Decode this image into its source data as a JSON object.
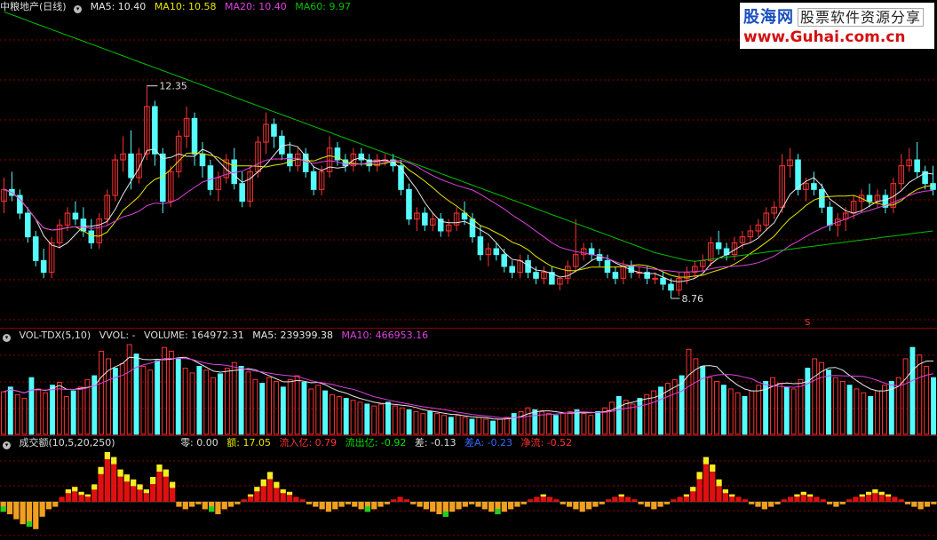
{
  "price_panel": {
    "stock_name": "中粮地产(日线)",
    "ma5": "MA5: 10.40",
    "ma10": "MA10: 10.58",
    "ma20": "MA20: 10.40",
    "ma60": "MA60: 9.97",
    "high_label": "12.35",
    "low_label": "8.76",
    "marker": "S"
  },
  "vol_panel": {
    "indicator": "VOL-TDX(5,10)",
    "vvol": "VVOL: -",
    "volume": "VOLUME: 164972.31",
    "ma5": "MA5: 239399.38",
    "ma10": "MA10: 466953.16"
  },
  "amount_panel": {
    "indicator": "成交额(10,5,20,250)",
    "ling": "零: 0.00",
    "e": "额: 17.05",
    "inflow": "流入亿: 0.79",
    "outflow": "流出亿: -0.92",
    "diff": "差: -0.13",
    "diff_a": "差A: -0.23",
    "net": "净流: -0.52"
  },
  "watermark": {
    "line1": "股海网",
    "line1b": "股票软件资源分享",
    "line2": "www.Guhai.com.cn"
  },
  "colors": {
    "up": "#ff3333",
    "down": "#54fcfc",
    "ma5": "#e6e6e6",
    "ma10": "#e6e600",
    "ma20": "#e040e0",
    "ma60": "#00c000",
    "grid": "#8b0000"
  },
  "chart_data": [
    {
      "type": "candlestick",
      "title": "中粮地产(日线)",
      "ylim": [
        8.4,
        13.5
      ],
      "annotations": [
        {
          "label": "12.35",
          "value": 12.35
        },
        {
          "label": "8.76",
          "value": 8.76
        }
      ],
      "ohlc": [
        [
          10.4,
          10.8,
          10.2,
          10.6
        ],
        [
          10.6,
          10.9,
          10.4,
          10.5
        ],
        [
          10.5,
          10.6,
          10.1,
          10.2
        ],
        [
          10.2,
          10.3,
          9.7,
          9.8
        ],
        [
          9.8,
          9.9,
          9.3,
          9.4
        ],
        [
          9.4,
          9.6,
          9.1,
          9.2
        ],
        [
          9.2,
          9.8,
          9.1,
          9.7
        ],
        [
          9.7,
          10.1,
          9.6,
          10.0
        ],
        [
          10.0,
          10.3,
          9.9,
          10.2
        ],
        [
          10.2,
          10.4,
          10.0,
          10.1
        ],
        [
          10.1,
          10.3,
          9.8,
          9.9
        ],
        [
          9.9,
          10.1,
          9.6,
          9.7
        ],
        [
          9.7,
          10.2,
          9.6,
          10.1
        ],
        [
          10.1,
          10.6,
          10.0,
          10.5
        ],
        [
          10.5,
          11.2,
          10.4,
          11.1
        ],
        [
          11.1,
          11.5,
          10.9,
          11.2
        ],
        [
          11.2,
          11.6,
          10.6,
          10.8
        ],
        [
          10.8,
          11.3,
          10.7,
          11.2
        ],
        [
          11.2,
          12.35,
          11.1,
          12.0
        ],
        [
          12.0,
          12.1,
          11.0,
          11.2
        ],
        [
          11.2,
          11.3,
          10.2,
          10.4
        ],
        [
          10.4,
          11.0,
          10.3,
          10.9
        ],
        [
          10.9,
          11.6,
          10.8,
          11.5
        ],
        [
          11.5,
          12.0,
          11.3,
          11.8
        ],
        [
          11.8,
          11.9,
          11.0,
          11.2
        ],
        [
          11.2,
          11.4,
          10.8,
          11.0
        ],
        [
          11.0,
          11.1,
          10.5,
          10.6
        ],
        [
          10.6,
          10.9,
          10.4,
          10.8
        ],
        [
          10.8,
          11.2,
          10.7,
          11.1
        ],
        [
          11.1,
          11.3,
          10.6,
          10.7
        ],
        [
          10.7,
          10.9,
          10.3,
          10.4
        ],
        [
          10.4,
          11.0,
          10.3,
          10.9
        ],
        [
          10.9,
          11.5,
          10.8,
          11.4
        ],
        [
          11.4,
          11.9,
          11.2,
          11.7
        ],
        [
          11.7,
          11.8,
          11.3,
          11.5
        ],
        [
          11.5,
          11.6,
          11.1,
          11.2
        ],
        [
          11.2,
          11.4,
          10.9,
          11.0
        ],
        [
          11.0,
          11.3,
          10.9,
          11.2
        ],
        [
          11.2,
          11.3,
          10.8,
          10.9
        ],
        [
          10.9,
          11.0,
          10.5,
          10.6
        ],
        [
          10.6,
          11.0,
          10.5,
          10.9
        ],
        [
          10.9,
          11.5,
          10.8,
          11.3
        ],
        [
          11.3,
          11.4,
          11.0,
          11.1
        ],
        [
          11.1,
          11.2,
          10.9,
          11.0
        ],
        [
          11.0,
          11.3,
          10.9,
          11.2
        ],
        [
          11.2,
          11.3,
          11.0,
          11.1
        ],
        [
          11.1,
          11.2,
          10.9,
          11.0
        ],
        [
          11.0,
          11.2,
          10.9,
          11.1
        ],
        [
          11.1,
          11.2,
          11.0,
          11.1
        ],
        [
          11.1,
          11.2,
          10.9,
          11.0
        ],
        [
          11.0,
          11.1,
          10.5,
          10.6
        ],
        [
          10.6,
          10.7,
          10.0,
          10.1
        ],
        [
          10.1,
          10.3,
          9.9,
          10.2
        ],
        [
          10.2,
          10.3,
          9.9,
          10.0
        ],
        [
          10.0,
          10.2,
          9.9,
          10.1
        ],
        [
          10.1,
          10.2,
          9.8,
          9.9
        ],
        [
          9.9,
          10.1,
          9.8,
          10.0
        ],
        [
          10.0,
          10.3,
          9.9,
          10.2
        ],
        [
          10.2,
          10.4,
          10.0,
          10.1
        ],
        [
          10.1,
          10.2,
          9.7,
          9.8
        ],
        [
          9.8,
          10.0,
          9.4,
          9.5
        ],
        [
          9.5,
          9.7,
          9.3,
          9.6
        ],
        [
          9.6,
          9.7,
          9.4,
          9.5
        ],
        [
          9.5,
          9.6,
          9.2,
          9.3
        ],
        [
          9.3,
          9.4,
          9.1,
          9.2
        ],
        [
          9.2,
          9.5,
          9.1,
          9.4
        ],
        [
          9.4,
          9.5,
          9.1,
          9.2
        ],
        [
          9.2,
          9.3,
          9.0,
          9.1
        ],
        [
          9.1,
          9.3,
          9.0,
          9.2
        ],
        [
          9.2,
          9.3,
          9.0,
          9.0
        ],
        [
          9.0,
          9.1,
          8.9,
          9.1
        ],
        [
          9.1,
          9.4,
          9.0,
          9.3
        ],
        [
          9.3,
          10.1,
          9.2,
          9.5
        ],
        [
          9.5,
          9.7,
          9.4,
          9.6
        ],
        [
          9.6,
          9.7,
          9.4,
          9.5
        ],
        [
          9.5,
          9.6,
          9.3,
          9.4
        ],
        [
          9.4,
          9.5,
          9.1,
          9.2
        ],
        [
          9.2,
          9.3,
          9.0,
          9.1
        ],
        [
          9.1,
          9.4,
          9.0,
          9.3
        ],
        [
          9.3,
          9.4,
          9.1,
          9.2
        ],
        [
          9.2,
          9.3,
          9.1,
          9.2
        ],
        [
          9.2,
          9.3,
          9.0,
          9.1
        ],
        [
          9.1,
          9.2,
          9.0,
          9.1
        ],
        [
          9.1,
          9.2,
          8.9,
          9.0
        ],
        [
          9.0,
          9.1,
          8.76,
          8.9
        ],
        [
          8.9,
          9.2,
          8.8,
          9.1
        ],
        [
          9.1,
          9.3,
          9.0,
          9.2
        ],
        [
          9.2,
          9.4,
          9.1,
          9.3
        ],
        [
          9.3,
          9.5,
          9.2,
          9.4
        ],
        [
          9.4,
          9.8,
          9.3,
          9.7
        ],
        [
          9.7,
          9.9,
          9.5,
          9.6
        ],
        [
          9.6,
          9.7,
          9.4,
          9.5
        ],
        [
          9.5,
          9.8,
          9.4,
          9.7
        ],
        [
          9.7,
          9.9,
          9.6,
          9.8
        ],
        [
          9.8,
          10.0,
          9.7,
          9.9
        ],
        [
          9.9,
          10.1,
          9.8,
          10.0
        ],
        [
          10.0,
          10.3,
          9.9,
          10.2
        ],
        [
          10.2,
          10.4,
          10.1,
          10.3
        ],
        [
          10.3,
          11.2,
          10.2,
          11.0
        ],
        [
          11.0,
          11.3,
          10.8,
          11.1
        ],
        [
          11.1,
          11.2,
          10.5,
          10.6
        ],
        [
          10.6,
          10.8,
          10.4,
          10.7
        ],
        [
          10.7,
          10.9,
          10.5,
          10.6
        ],
        [
          10.6,
          10.7,
          10.2,
          10.3
        ],
        [
          10.3,
          10.4,
          9.9,
          10.0
        ],
        [
          10.0,
          10.2,
          9.8,
          10.1
        ],
        [
          10.1,
          10.3,
          9.9,
          10.2
        ],
        [
          10.2,
          10.5,
          10.1,
          10.4
        ],
        [
          10.4,
          10.6,
          10.2,
          10.5
        ],
        [
          10.5,
          10.7,
          10.3,
          10.4
        ],
        [
          10.4,
          10.6,
          10.3,
          10.5
        ],
        [
          10.5,
          10.6,
          10.2,
          10.3
        ],
        [
          10.3,
          10.8,
          10.2,
          10.7
        ],
        [
          10.7,
          11.2,
          10.6,
          11.0
        ],
        [
          11.0,
          11.3,
          10.9,
          11.1
        ],
        [
          11.1,
          11.4,
          10.8,
          10.9
        ],
        [
          10.9,
          11.0,
          10.6,
          10.7
        ],
        [
          10.7,
          11.0,
          10.5,
          10.6
        ]
      ]
    },
    {
      "type": "bar",
      "title": "VOL-TDX(5,10)",
      "values": [
        45,
        50,
        42,
        38,
        60,
        48,
        44,
        52,
        55,
        40,
        46,
        50,
        58,
        62,
        88,
        80,
        70,
        75,
        95,
        85,
        72,
        68,
        78,
        92,
        88,
        80,
        70,
        65,
        72,
        68,
        60,
        64,
        70,
        76,
        72,
        66,
        58,
        54,
        60,
        56,
        50,
        58,
        62,
        55,
        48,
        52,
        46,
        42,
        40,
        38,
        36,
        34,
        32,
        30,
        32,
        34,
        30,
        28,
        26,
        24,
        22,
        24,
        22,
        20,
        18,
        20,
        18,
        16,
        18,
        16,
        14,
        16,
        18,
        22,
        24,
        28,
        26,
        24,
        22,
        20,
        22,
        24,
        26,
        22,
        20,
        24,
        28,
        34,
        40,
        36,
        32,
        38,
        42,
        46,
        50,
        54,
        58,
        62,
        90,
        80,
        72,
        60,
        56,
        52,
        48,
        44,
        40,
        46,
        52,
        56,
        60,
        54,
        50,
        48,
        58,
        70,
        80,
        76,
        68,
        60,
        56,
        52,
        48,
        44,
        40,
        46,
        52,
        56,
        60,
        80,
        92,
        84,
        72,
        60
      ]
    },
    {
      "type": "bar",
      "title": "成交额(10,5,20,250)",
      "values": [
        -8,
        -10,
        -14,
        -18,
        -20,
        -22,
        -12,
        -6,
        -4,
        4,
        10,
        12,
        8,
        6,
        14,
        28,
        40,
        36,
        26,
        22,
        18,
        14,
        10,
        20,
        30,
        26,
        16,
        -4,
        -6,
        -4,
        -2,
        -6,
        -8,
        -10,
        -6,
        -4,
        -2,
        2,
        6,
        12,
        18,
        24,
        16,
        10,
        8,
        4,
        2,
        -2,
        -4,
        -6,
        -8,
        -6,
        -4,
        -2,
        -4,
        -6,
        -8,
        -6,
        -4,
        -2,
        2,
        4,
        2,
        -2,
        -4,
        -6,
        -8,
        -10,
        -12,
        -8,
        -6,
        -4,
        -2,
        -4,
        -6,
        -8,
        -10,
        -8,
        -6,
        -4,
        -2,
        2,
        4,
        6,
        4,
        2,
        -2,
        -4,
        -6,
        -8,
        -6,
        -4,
        -2,
        2,
        4,
        6,
        4,
        2,
        -2,
        -4,
        -6,
        -4,
        -2,
        2,
        4,
        6,
        12,
        24,
        36,
        30,
        18,
        10,
        6,
        4,
        2,
        -2,
        -4,
        -6,
        -4,
        -2,
        2,
        4,
        6,
        8,
        6,
        4,
        2,
        -2,
        -4,
        -2,
        2,
        4,
        6,
        8,
        10,
        8,
        6,
        4,
        2,
        -2,
        -4,
        -6,
        -4,
        -2
      ]
    }
  ]
}
